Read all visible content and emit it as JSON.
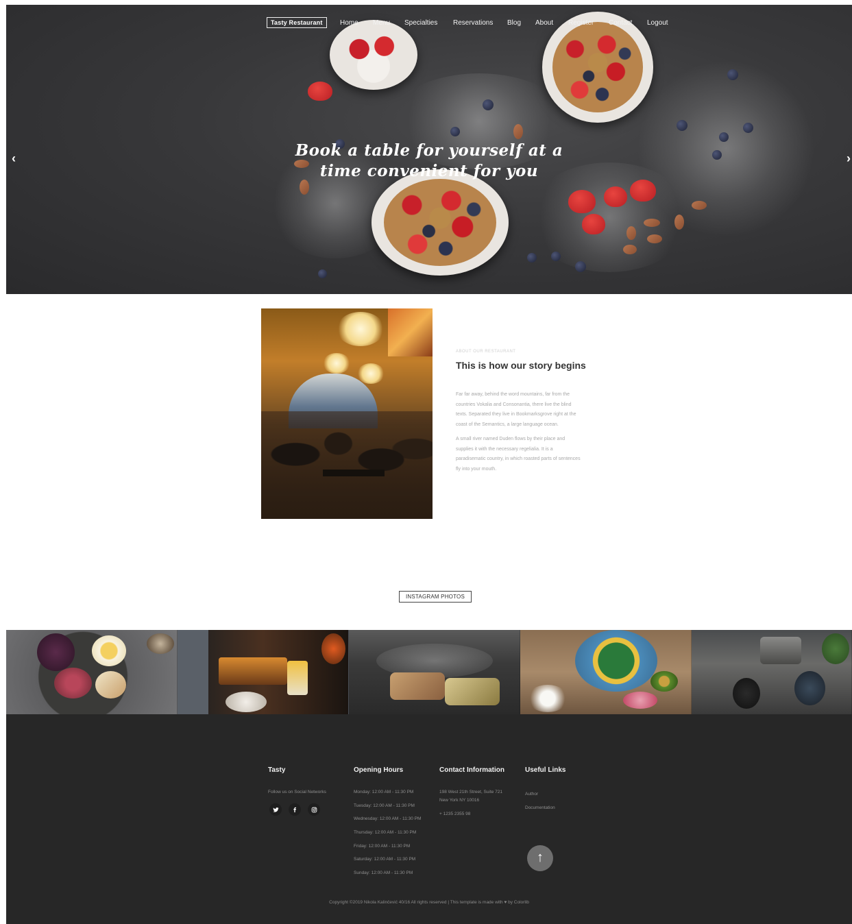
{
  "nav": {
    "brand": "Tasty Restaurant",
    "items": [
      "Home",
      "Menu",
      "Specialties",
      "Reservations",
      "Blog",
      "About",
      "Register",
      "Contact",
      "Logout"
    ]
  },
  "hero": {
    "line1": "Book a table for yourself at a",
    "line2": "time convenient for you",
    "prev_arrow": "‹",
    "next_arrow": "›"
  },
  "about": {
    "subheading": "ABOUT OUR RESTAURANT",
    "title": "This is how our story begins",
    "paragraph1": "Far far away, behind the word mountains, far from the countries Vokalia and Consonantia, there live the blind texts. Separated they live in Bookmarksgrove right at the coast of the Semantics, a large language ocean.",
    "paragraph2": "A small river named Duden flows by their place and supplies it with the necessary regelialia. It is a paradisematic country, in which roasted parts of sentences fly into your mouth."
  },
  "instagram": {
    "label": "INSTAGRAM PHOTOS"
  },
  "footer": {
    "tasty": {
      "title": "Tasty",
      "follow": "Follow us on Social Networks",
      "social_icons": [
        "twitter-icon",
        "facebook-icon",
        "instagram-icon"
      ]
    },
    "hours": {
      "title": "Opening Hours",
      "days": [
        "Monday: 12:00 AM - 11:30 PM",
        "Tuesday: 12:00 AM - 11:30 PM",
        "Wednesday: 12:00 AM - 11:30 PM",
        "Thursday: 12:00 AM - 11:30 PM",
        "Friday: 12:00 AM - 11:30 PM",
        "Saturday: 12:00 AM - 11:30 PM",
        "Sunday: 12:00 AM - 11:30 PM"
      ]
    },
    "contact": {
      "title": "Contact Information",
      "address_line1": "198 West 21th Street, Suite 721",
      "address_line2": "New York NY 10016",
      "phone": "+ 1235 2355 98"
    },
    "links": {
      "title": "Useful Links",
      "items": [
        "Author",
        "Documentation"
      ]
    },
    "back_to_top": "↑",
    "copyright": "Copyright ©2019 Nikola Kalinčević 40/16 All rights reserved | This template is made with ♥ by Colorlib"
  }
}
